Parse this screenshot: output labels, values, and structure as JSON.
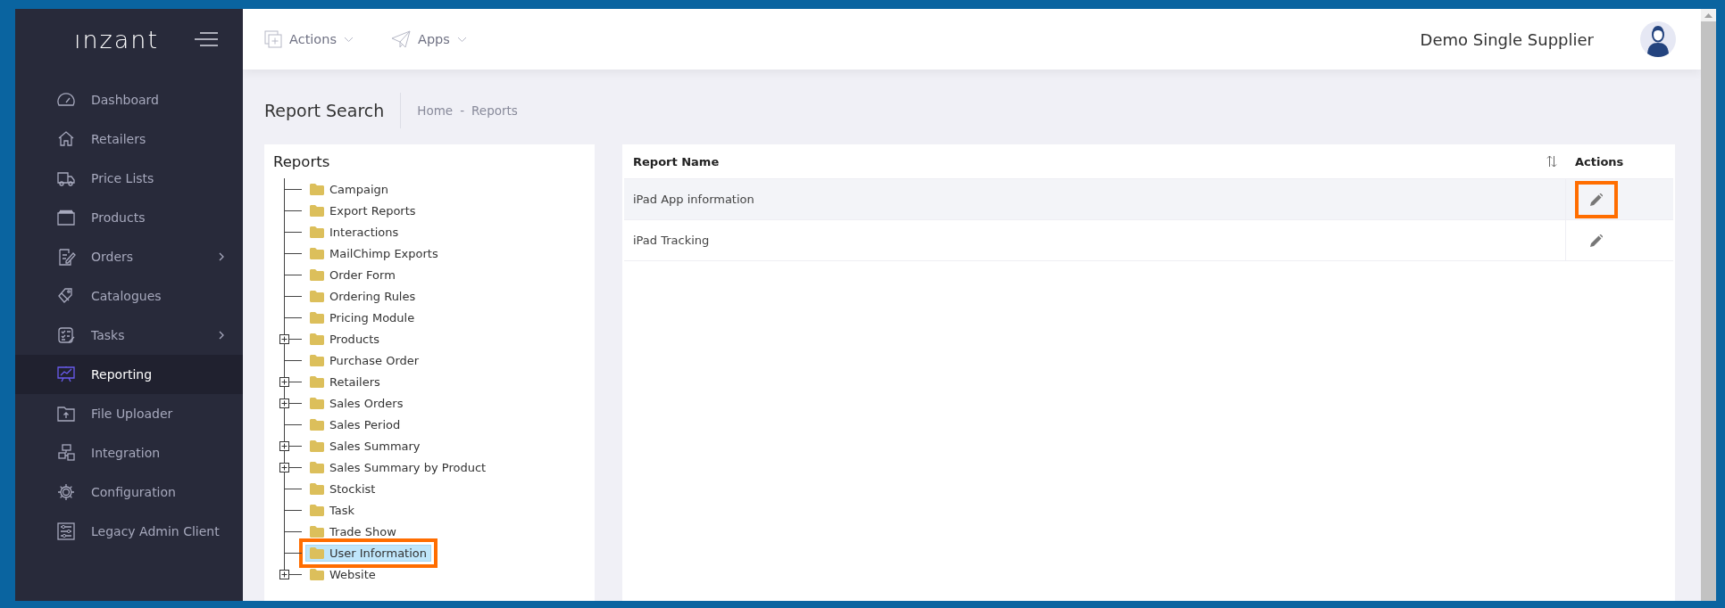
{
  "sidebar": {
    "logo": "ınzant",
    "items": [
      {
        "label": "Dashboard",
        "selected": false,
        "has_submenu": false
      },
      {
        "label": "Retailers",
        "selected": false,
        "has_submenu": false
      },
      {
        "label": "Price Lists",
        "selected": false,
        "has_submenu": false
      },
      {
        "label": "Products",
        "selected": false,
        "has_submenu": false
      },
      {
        "label": "Orders",
        "selected": false,
        "has_submenu": true
      },
      {
        "label": "Catalogues",
        "selected": false,
        "has_submenu": false
      },
      {
        "label": "Tasks",
        "selected": false,
        "has_submenu": true
      },
      {
        "label": "Reporting",
        "selected": true,
        "has_submenu": false
      },
      {
        "label": "File Uploader",
        "selected": false,
        "has_submenu": false
      },
      {
        "label": "Integration",
        "selected": false,
        "has_submenu": false
      },
      {
        "label": "Configuration",
        "selected": false,
        "has_submenu": false
      },
      {
        "label": "Legacy Admin Client",
        "selected": false,
        "has_submenu": false
      }
    ]
  },
  "topbar": {
    "menus": [
      "Actions",
      "Apps"
    ],
    "user": "Demo Single Supplier"
  },
  "page": {
    "title": "Report Search",
    "breadcrumb": [
      "Home",
      "Reports"
    ],
    "breadcrumb_separator": "-"
  },
  "tree": {
    "title": "Reports",
    "items": [
      {
        "label": "Campaign",
        "expandable": false,
        "selected": false,
        "annotated": false
      },
      {
        "label": "Export Reports",
        "expandable": false,
        "selected": false,
        "annotated": false
      },
      {
        "label": "Interactions",
        "expandable": false,
        "selected": false,
        "annotated": false
      },
      {
        "label": "MailChimp Exports",
        "expandable": false,
        "selected": false,
        "annotated": false
      },
      {
        "label": "Order Form",
        "expandable": false,
        "selected": false,
        "annotated": false
      },
      {
        "label": "Ordering Rules",
        "expandable": false,
        "selected": false,
        "annotated": false
      },
      {
        "label": "Pricing Module",
        "expandable": false,
        "selected": false,
        "annotated": false
      },
      {
        "label": "Products",
        "expandable": true,
        "selected": false,
        "annotated": false
      },
      {
        "label": "Purchase Order",
        "expandable": false,
        "selected": false,
        "annotated": false
      },
      {
        "label": "Retailers",
        "expandable": true,
        "selected": false,
        "annotated": false
      },
      {
        "label": "Sales Orders",
        "expandable": true,
        "selected": false,
        "annotated": false
      },
      {
        "label": "Sales Period",
        "expandable": false,
        "selected": false,
        "annotated": false
      },
      {
        "label": "Sales Summary",
        "expandable": true,
        "selected": false,
        "annotated": false
      },
      {
        "label": "Sales Summary by Product",
        "expandable": true,
        "selected": false,
        "annotated": false
      },
      {
        "label": "Stockist",
        "expandable": false,
        "selected": false,
        "annotated": false
      },
      {
        "label": "Task",
        "expandable": false,
        "selected": false,
        "annotated": false
      },
      {
        "label": "Trade Show",
        "expandable": false,
        "selected": false,
        "annotated": false
      },
      {
        "label": "User Information",
        "expandable": false,
        "selected": true,
        "annotated": true
      },
      {
        "label": "Website",
        "expandable": true,
        "selected": false,
        "annotated": false
      }
    ]
  },
  "table": {
    "columns": [
      "Report Name",
      "Actions"
    ],
    "rows": [
      {
        "name": "iPad App information",
        "hovered": true,
        "annotated": true
      },
      {
        "name": "iPad Tracking",
        "hovered": false,
        "annotated": false
      }
    ]
  }
}
